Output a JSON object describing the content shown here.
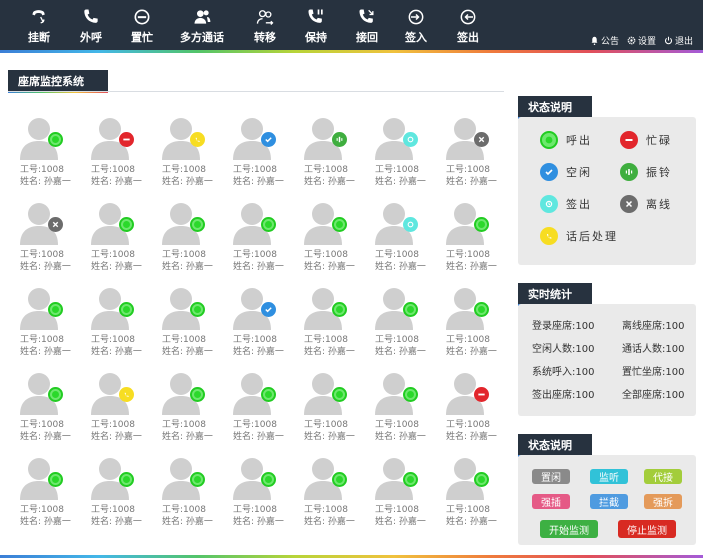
{
  "toolbar": {
    "buttons": [
      {
        "label": "挂断",
        "icon": "hangup-icon"
      },
      {
        "label": "外呼",
        "icon": "phone-icon"
      },
      {
        "label": "置忙",
        "icon": "minus-circle-icon"
      },
      {
        "label": "多方通话",
        "icon": "group-icon"
      },
      {
        "label": "转移",
        "icon": "transfer-icon"
      },
      {
        "label": "保持",
        "icon": "hold-phone-icon"
      },
      {
        "label": "接回",
        "icon": "retrieve-phone-icon"
      },
      {
        "label": "签入",
        "icon": "sign-in-icon"
      },
      {
        "label": "签出",
        "icon": "sign-out-icon"
      }
    ],
    "links": [
      {
        "label": "公告",
        "icon": "bell-icon"
      },
      {
        "label": "设置",
        "icon": "gear-icon"
      },
      {
        "label": "退出",
        "icon": "power-icon"
      }
    ]
  },
  "monitor": {
    "title": "座席监控系统",
    "agent_id_label": "工号:1008",
    "agent_name_label": "姓名: 孙嘉一",
    "statuses": [
      "call",
      "busy",
      "post",
      "free",
      "ring",
      "sign",
      "off",
      "off",
      "call",
      "call",
      "call",
      "call",
      "sign",
      "call",
      "call",
      "call",
      "call",
      "free",
      "call",
      "call",
      "call",
      "call",
      "post",
      "call",
      "call",
      "call",
      "call",
      "busy",
      "call",
      "call",
      "call",
      "call",
      "call",
      "call",
      "call"
    ]
  },
  "legend": {
    "title": "状态说明",
    "items": [
      {
        "label": "呼出",
        "status": "call"
      },
      {
        "label": "忙碌",
        "status": "busy"
      },
      {
        "label": "空闲",
        "status": "free"
      },
      {
        "label": "振铃",
        "status": "ring"
      },
      {
        "label": "签出",
        "status": "sign"
      },
      {
        "label": "离线",
        "status": "off"
      },
      {
        "label": "话后处理",
        "status": "post"
      }
    ]
  },
  "stats": {
    "title": "实时统计",
    "items": [
      "登录座席:100",
      "离线座席:100",
      "空闲人数:100",
      "通话人数:100",
      "系统呼入:100",
      "置忙坐席:100",
      "签出座席:100",
      "全部座席:100"
    ]
  },
  "actions": {
    "title": "状态说明",
    "pills": [
      {
        "label": "置闲",
        "color": "#8a8a8a"
      },
      {
        "label": "监听",
        "color": "#31c2d8"
      },
      {
        "label": "代接",
        "color": "#a3cd3b"
      },
      {
        "label": "强插",
        "color": "#e55a86"
      },
      {
        "label": "拦截",
        "color": "#4f9be0"
      },
      {
        "label": "强拆",
        "color": "#e49a5a"
      }
    ],
    "start_label": "开始监测",
    "stop_label": "停止监测",
    "start_color": "#3db043",
    "stop_color": "#d82a22"
  },
  "colors": {
    "toolbar_bg": "#27323f",
    "call": "#22cc22",
    "busy": "#e2262c",
    "free": "#2f8fe0",
    "ring": "#3fae3f",
    "sign": "#5fe7df",
    "off": "#6c6c6c",
    "post": "#f7dd22"
  }
}
